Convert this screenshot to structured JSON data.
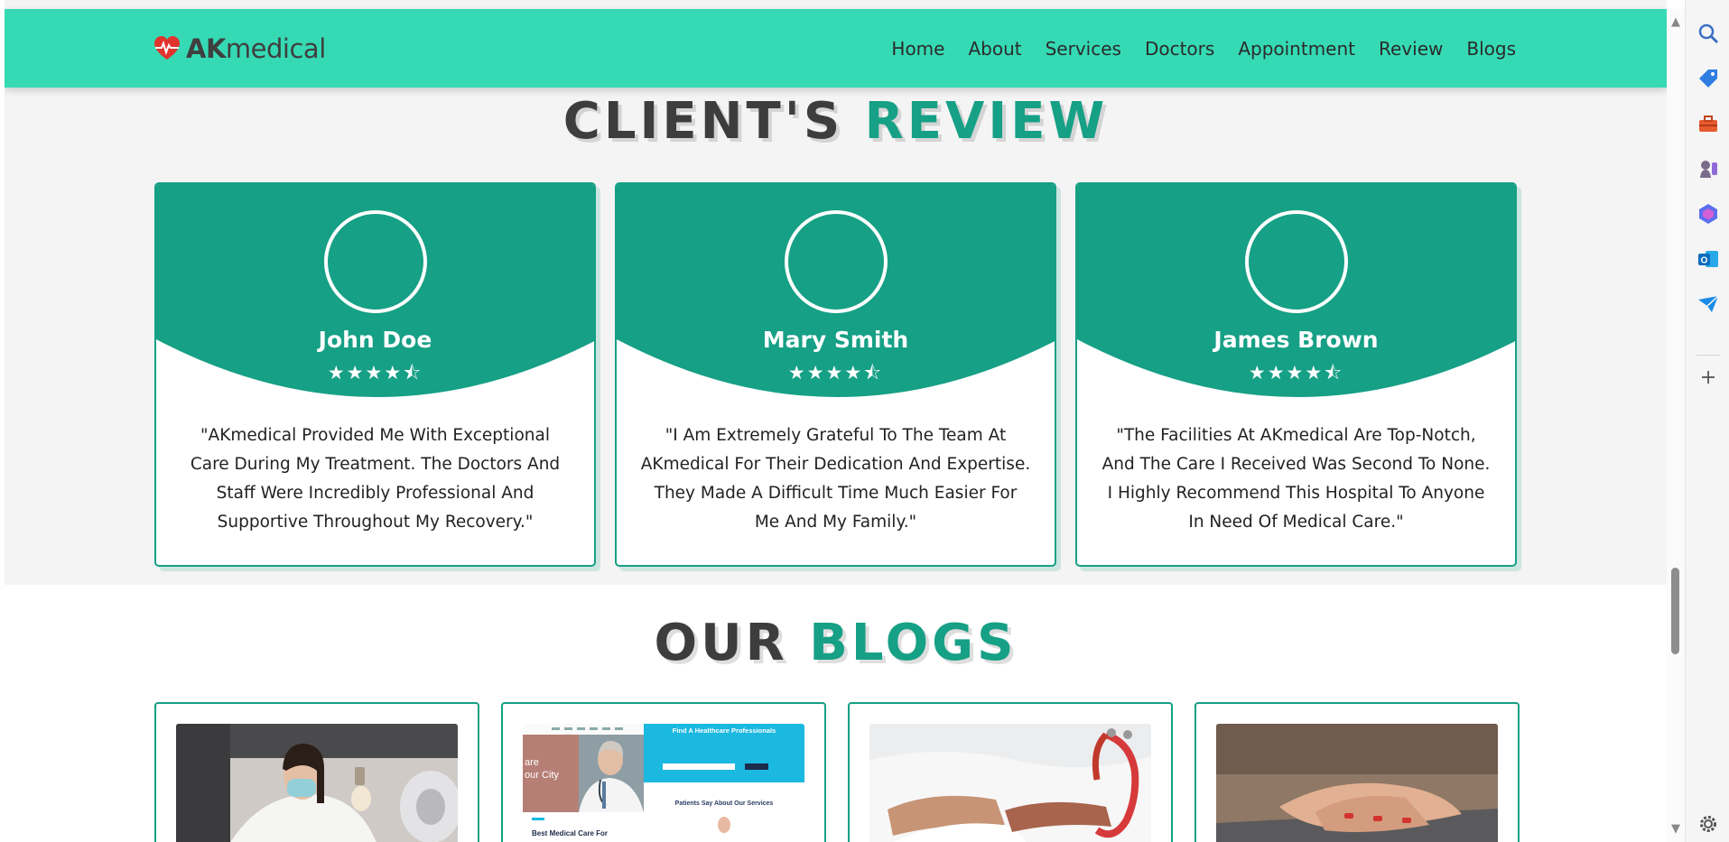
{
  "brand": {
    "name_bold": "AK",
    "name_regular": "medical",
    "logo_icon": "heart-pulse-icon",
    "accent_color": "#16a085",
    "header_color": "#35dab4"
  },
  "nav": {
    "items": [
      {
        "label": "Home"
      },
      {
        "label": "About"
      },
      {
        "label": "Services"
      },
      {
        "label": "Doctors"
      },
      {
        "label": "Appointment"
      },
      {
        "label": "Review"
      },
      {
        "label": "Blogs"
      }
    ]
  },
  "review_section": {
    "title_dark": "CLIENT'S",
    "title_accent": "REVIEW",
    "reviews": [
      {
        "name": "John Doe",
        "stars": "★★★★⯪",
        "rating": 4.5,
        "quote": "\"AKmedical Provided Me With Exceptional Care During My Treatment. The Doctors And Staff Were Incredibly Professional And Supportive Throughout My Recovery.\""
      },
      {
        "name": "Mary Smith",
        "stars": "★★★★⯪",
        "rating": 4.5,
        "quote": "\"I Am Extremely Grateful To The Team At AKmedical For Their Dedication And Expertise. They Made A Difficult Time Much Easier For Me And My Family.\""
      },
      {
        "name": "James Brown",
        "stars": "★★★★⯪",
        "rating": 4.5,
        "quote": "\"The Facilities At AKmedical Are Top-Notch, And The Care I Received Was Second To None. I Highly Recommend This Hospital To Anyone In Need Of Medical Care.\""
      }
    ]
  },
  "blogs_section": {
    "title_dark": "OUR",
    "title_accent": "BLOGS",
    "blogs": [
      {
        "image": "scientist-with-mask-photo"
      },
      {
        "image": "healthcare-website-screenshot",
        "screenshot_heading": "Find A Healthcare Professionals",
        "screenshot_left_text_1": "are",
        "screenshot_left_text_2": "our City",
        "screenshot_subheading": "Patients Say About Our Services",
        "screenshot_bottom_text": "Best Medical Care For"
      },
      {
        "image": "doctor-with-stethoscope-photo"
      },
      {
        "image": "typing-on-laptop-photo"
      }
    ]
  },
  "browser_sidebar": {
    "icons": [
      "search-icon",
      "tag-icon",
      "toolbox-icon",
      "chess-icon",
      "copilot-icon",
      "outlook-icon",
      "send-icon",
      "add-icon",
      "settings-icon"
    ]
  }
}
